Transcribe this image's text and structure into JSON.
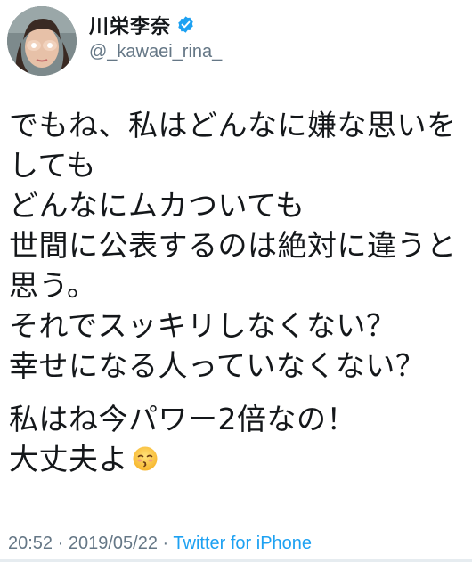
{
  "user": {
    "display_name": "川栄李奈",
    "handle": "@_kawaei_rina_",
    "verified_icon": "verified-badge-icon",
    "verified_color": "#1da1f2"
  },
  "tweet": {
    "paragraphs": [
      {
        "lines": [
          "でもね、私はどんなに嫌な思いを",
          "しても",
          "どんなにムカついても",
          "世間に公表するのは絶対に違うと",
          "思う。",
          "それでスッキリしなくない？",
          "幸せになる人っていなくない？"
        ]
      },
      {
        "lines": [
          "私はね今パワー2倍なの！",
          "大丈夫よ"
        ],
        "trailing_emoji": "kissing-face-closed-eyes-emoji"
      }
    ]
  },
  "meta": {
    "time": "20:52",
    "separator": "·",
    "date": "2019/05/22",
    "source": "Twitter for iPhone",
    "source_color": "#1da1f2",
    "text_color": "#657786"
  }
}
